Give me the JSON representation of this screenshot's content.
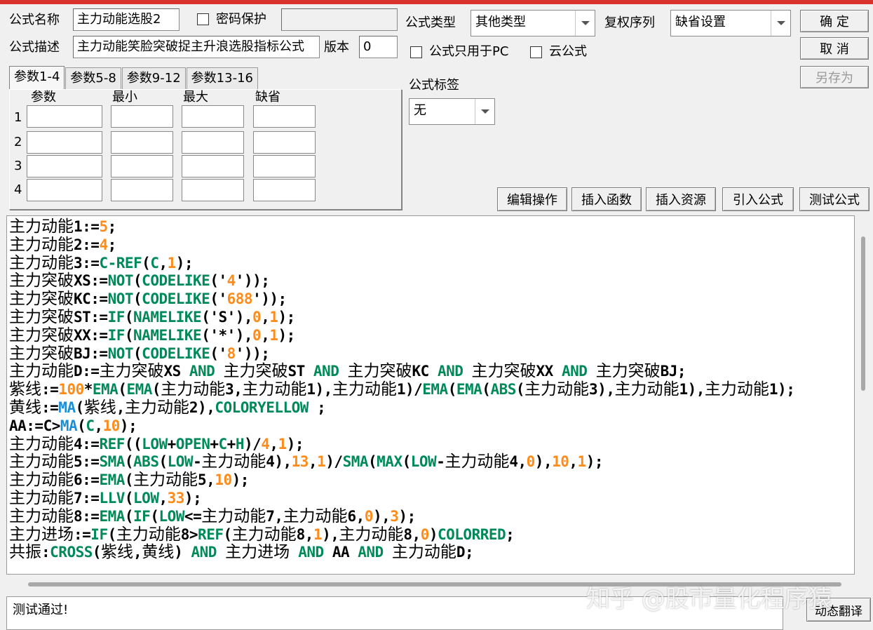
{
  "header": {
    "formula_name_label": "公式名称",
    "formula_name_value": "主力动能选股2",
    "password_label": "密码保护",
    "password_value": "",
    "formula_desc_label": "公式描述",
    "formula_desc_value": "主力动能笑脸突破捉主升浪选股指标公式",
    "version_label": "版本",
    "version_value": "0",
    "formula_type_label": "公式类型",
    "formula_type_value": "其他类型",
    "rights_label": "复权序列",
    "rights_value": "缺省设置",
    "pc_only_label": "公式只用于PC",
    "cloud_label": "云公式",
    "tag_label": "公式标签",
    "tag_value": "无"
  },
  "buttons": {
    "ok": "确  定",
    "cancel": "取  消",
    "save_as": "另存为",
    "edit_ops": "编辑操作",
    "insert_func": "插入函数",
    "insert_res": "插入资源",
    "import_formula": "引入公式",
    "test_formula": "测试公式",
    "dynamic_translate": "动态翻译"
  },
  "param_tabs": [
    "参数1-4",
    "参数5-8",
    "参数9-12",
    "参数13-16"
  ],
  "param_columns": [
    "参数",
    "最小",
    "最大",
    "缺省"
  ],
  "param_rows": [
    "1",
    "2",
    "3",
    "4"
  ],
  "code_lines": [
    [
      [
        "主力动能",
        "cn"
      ],
      [
        "1:=",
        ""
      ],
      [
        "5",
        "n"
      ],
      [
        ";",
        ""
      ]
    ],
    [
      [
        "主力动能",
        "cn"
      ],
      [
        "2:=",
        ""
      ],
      [
        "4",
        "n"
      ],
      [
        ";",
        ""
      ]
    ],
    [
      [
        "主力动能",
        "cn"
      ],
      [
        "3:=",
        ""
      ],
      [
        "C-",
        "f"
      ],
      [
        "REF",
        "f"
      ],
      [
        "(",
        ""
      ],
      [
        "C",
        "f"
      ],
      [
        ",",
        ""
      ],
      [
        "1",
        "n"
      ],
      [
        ");",
        ""
      ]
    ],
    [
      [
        "主力突破",
        "cn"
      ],
      [
        "XS:=",
        ""
      ],
      [
        "NOT",
        "f"
      ],
      [
        "(",
        ""
      ],
      [
        "CODELIKE",
        "f"
      ],
      [
        "('",
        ""
      ],
      [
        "4",
        "n"
      ],
      [
        "'));",
        ""
      ]
    ],
    [
      [
        "主力突破",
        "cn"
      ],
      [
        "KC:=",
        ""
      ],
      [
        "NOT",
        "f"
      ],
      [
        "(",
        ""
      ],
      [
        "CODELIKE",
        "f"
      ],
      [
        "('",
        ""
      ],
      [
        "688",
        "n"
      ],
      [
        "'));",
        ""
      ]
    ],
    [
      [
        "主力突破",
        "cn"
      ],
      [
        "ST:=",
        ""
      ],
      [
        "IF",
        "f"
      ],
      [
        "(",
        ""
      ],
      [
        "NAMELIKE",
        "f"
      ],
      [
        "('S'),",
        ""
      ],
      [
        "0",
        "n"
      ],
      [
        ",",
        ""
      ],
      [
        "1",
        "n"
      ],
      [
        ");",
        ""
      ]
    ],
    [
      [
        "主力突破",
        "cn"
      ],
      [
        "XX:=",
        ""
      ],
      [
        "IF",
        "f"
      ],
      [
        "(",
        ""
      ],
      [
        "NAMELIKE",
        "f"
      ],
      [
        "('*'),",
        ""
      ],
      [
        "0",
        "n"
      ],
      [
        ",",
        ""
      ],
      [
        "1",
        "n"
      ],
      [
        ");",
        ""
      ]
    ],
    [
      [
        "主力突破",
        "cn"
      ],
      [
        "BJ:=",
        ""
      ],
      [
        "NOT",
        "f"
      ],
      [
        "(",
        ""
      ],
      [
        "CODELIKE",
        "f"
      ],
      [
        "('",
        ""
      ],
      [
        "8",
        "n"
      ],
      [
        "'));",
        ""
      ]
    ],
    [
      [
        "主力动能",
        "cn"
      ],
      [
        "D:=",
        ""
      ],
      [
        "主力突破",
        "cn"
      ],
      [
        "XS ",
        ""
      ],
      [
        "AND",
        "f"
      ],
      [
        " ",
        ""
      ],
      [
        "主力突破",
        "cn"
      ],
      [
        "ST ",
        ""
      ],
      [
        "AND",
        "f"
      ],
      [
        " ",
        ""
      ],
      [
        "主力突破",
        "cn"
      ],
      [
        "KC ",
        ""
      ],
      [
        "AND",
        "f"
      ],
      [
        " ",
        ""
      ],
      [
        "主力突破",
        "cn"
      ],
      [
        "XX ",
        ""
      ],
      [
        "AND",
        "f"
      ],
      [
        " ",
        ""
      ],
      [
        "主力突破",
        "cn"
      ],
      [
        "BJ;",
        ""
      ]
    ],
    [
      [
        "紫线",
        "cn"
      ],
      [
        ":=",
        ""
      ],
      [
        "100",
        "n"
      ],
      [
        "*",
        ""
      ],
      [
        "EMA",
        "f"
      ],
      [
        "(",
        ""
      ],
      [
        "EMA",
        "f"
      ],
      [
        "(",
        ""
      ],
      [
        "主力动能",
        "cn"
      ],
      [
        "3,",
        ""
      ],
      [
        "主力动能",
        "cn"
      ],
      [
        "1),",
        ""
      ],
      [
        "主力动能",
        "cn"
      ],
      [
        "1)/",
        ""
      ],
      [
        "EMA",
        "f"
      ],
      [
        "(",
        ""
      ],
      [
        "EMA",
        "f"
      ],
      [
        "(",
        ""
      ],
      [
        "ABS",
        "f"
      ],
      [
        "(",
        ""
      ],
      [
        "主力动能",
        "cn"
      ],
      [
        "3),",
        ""
      ],
      [
        "主力动能",
        "cn"
      ],
      [
        "1),",
        ""
      ],
      [
        "主力动能",
        "cn"
      ],
      [
        "1);",
        ""
      ]
    ],
    [
      [
        "黄线",
        "cn"
      ],
      [
        ":=",
        ""
      ],
      [
        "MA",
        "b"
      ],
      [
        "(",
        ""
      ],
      [
        "紫线",
        "cn"
      ],
      [
        ",",
        ""
      ],
      [
        "主力动能",
        "cn"
      ],
      [
        "2),",
        ""
      ],
      [
        "COLORYELLOW",
        "f"
      ],
      [
        " ;",
        ""
      ]
    ],
    [
      [
        "AA:=C>",
        ""
      ],
      [
        "MA",
        "b"
      ],
      [
        "(",
        ""
      ],
      [
        "C",
        "f"
      ],
      [
        ",",
        ""
      ],
      [
        "10",
        "n"
      ],
      [
        ");",
        ""
      ]
    ],
    [
      [
        "主力动能",
        "cn"
      ],
      [
        "4:=",
        ""
      ],
      [
        "REF",
        "f"
      ],
      [
        "((",
        ""
      ],
      [
        "LOW",
        "f"
      ],
      [
        "+",
        ""
      ],
      [
        "OPEN",
        "f"
      ],
      [
        "+",
        ""
      ],
      [
        "C",
        "f"
      ],
      [
        "+",
        ""
      ],
      [
        "H",
        "f"
      ],
      [
        ")/",
        ""
      ],
      [
        "4",
        "n"
      ],
      [
        ",",
        ""
      ],
      [
        "1",
        "n"
      ],
      [
        ");",
        ""
      ]
    ],
    [
      [
        "主力动能",
        "cn"
      ],
      [
        "5:=",
        ""
      ],
      [
        "SMA",
        "f"
      ],
      [
        "(",
        ""
      ],
      [
        "ABS",
        "f"
      ],
      [
        "(",
        ""
      ],
      [
        "LOW",
        "f"
      ],
      [
        "-",
        ""
      ],
      [
        "主力动能",
        "cn"
      ],
      [
        "4),",
        ""
      ],
      [
        "13",
        "n"
      ],
      [
        ",",
        ""
      ],
      [
        "1",
        "n"
      ],
      [
        ")/",
        ""
      ],
      [
        "SMA",
        "f"
      ],
      [
        "(",
        ""
      ],
      [
        "MAX",
        "f"
      ],
      [
        "(",
        ""
      ],
      [
        "LOW",
        "f"
      ],
      [
        "-",
        ""
      ],
      [
        "主力动能",
        "cn"
      ],
      [
        "4,",
        ""
      ],
      [
        "0",
        "n"
      ],
      [
        "),",
        ""
      ],
      [
        "10",
        "n"
      ],
      [
        ",",
        ""
      ],
      [
        "1",
        "n"
      ],
      [
        ");",
        ""
      ]
    ],
    [
      [
        "主力动能",
        "cn"
      ],
      [
        "6:=",
        ""
      ],
      [
        "EMA",
        "f"
      ],
      [
        "(",
        ""
      ],
      [
        "主力动能",
        "cn"
      ],
      [
        "5,",
        ""
      ],
      [
        "10",
        "n"
      ],
      [
        ");",
        ""
      ]
    ],
    [
      [
        "主力动能",
        "cn"
      ],
      [
        "7:=",
        ""
      ],
      [
        "LLV",
        "f"
      ],
      [
        "(",
        ""
      ],
      [
        "LOW",
        "f"
      ],
      [
        ",",
        ""
      ],
      [
        "33",
        "n"
      ],
      [
        ");",
        ""
      ]
    ],
    [
      [
        "主力动能",
        "cn"
      ],
      [
        "8:=",
        ""
      ],
      [
        "EMA",
        "f"
      ],
      [
        "(",
        ""
      ],
      [
        "IF",
        "f"
      ],
      [
        "(",
        ""
      ],
      [
        "LOW",
        "f"
      ],
      [
        "<=",
        ""
      ],
      [
        "主力动能",
        "cn"
      ],
      [
        "7,",
        ""
      ],
      [
        "主力动能",
        "cn"
      ],
      [
        "6,",
        ""
      ],
      [
        "0",
        "n"
      ],
      [
        "),",
        ""
      ],
      [
        "3",
        "n"
      ],
      [
        ");",
        ""
      ]
    ],
    [
      [
        "主力进场",
        "cn"
      ],
      [
        ":=",
        ""
      ],
      [
        "IF",
        "f"
      ],
      [
        "(",
        ""
      ],
      [
        "主力动能",
        "cn"
      ],
      [
        "8>",
        ""
      ],
      [
        "REF",
        "f"
      ],
      [
        "(",
        ""
      ],
      [
        "主力动能",
        "cn"
      ],
      [
        "8,",
        ""
      ],
      [
        "1",
        "n"
      ],
      [
        "),",
        ""
      ],
      [
        "主力动能",
        "cn"
      ],
      [
        "8,",
        ""
      ],
      [
        "0",
        "n"
      ],
      [
        ")",
        ""
      ],
      [
        "COLORRED",
        "f"
      ],
      [
        ";",
        ""
      ]
    ],
    [
      [
        "共振",
        "cn"
      ],
      [
        ":",
        ""
      ],
      [
        "CROSS",
        "f"
      ],
      [
        "(",
        ""
      ],
      [
        "紫线",
        "cn"
      ],
      [
        ",",
        ""
      ],
      [
        "黄线",
        "cn"
      ],
      [
        ") ",
        ""
      ],
      [
        "AND",
        "f"
      ],
      [
        " ",
        ""
      ],
      [
        "主力进场",
        "cn"
      ],
      [
        " ",
        ""
      ],
      [
        "AND",
        "f"
      ],
      [
        " AA ",
        ""
      ],
      [
        "AND",
        "f"
      ],
      [
        " ",
        ""
      ],
      [
        "主力动能",
        "cn"
      ],
      [
        "D;",
        ""
      ]
    ]
  ],
  "status_text": "测试通过!",
  "watermark": "知乎 @股市量化程序猿"
}
